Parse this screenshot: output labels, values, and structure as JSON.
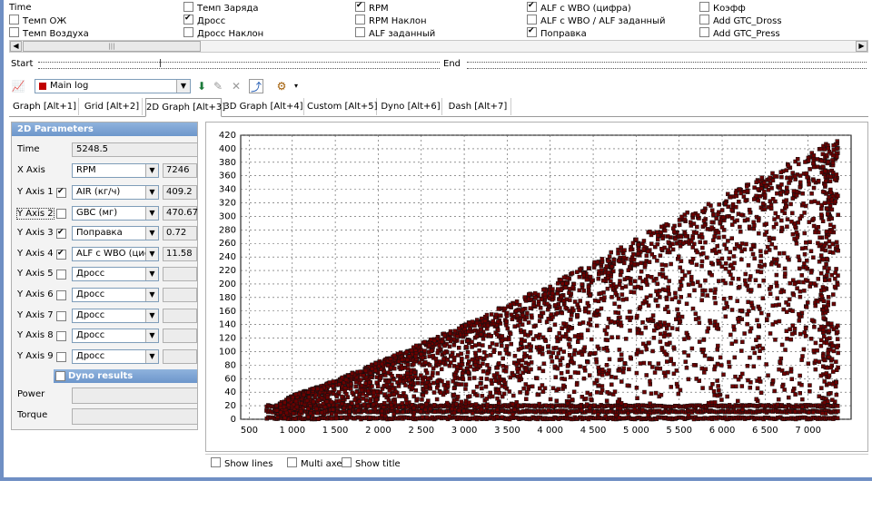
{
  "checkbox_columns": [
    [
      {
        "label": "Time",
        "checked": null
      },
      {
        "label": "Темп ОЖ",
        "checked": false
      },
      {
        "label": "Темп Воздуха",
        "checked": false
      }
    ],
    [
      {
        "label": "Темп Заряда",
        "checked": false
      },
      {
        "label": "Дросс",
        "checked": true
      },
      {
        "label": "Дросс Наклон",
        "checked": false
      }
    ],
    [
      {
        "label": "RPM",
        "checked": true
      },
      {
        "label": "RPM Наклон",
        "checked": false
      },
      {
        "label": "ALF заданный",
        "checked": false
      }
    ],
    [
      {
        "label": "ALF с WBO (цифра)",
        "checked": true
      },
      {
        "label": "ALF с WBO / ALF заданный",
        "checked": false
      },
      {
        "label": "Поправка",
        "checked": true
      }
    ],
    [
      {
        "label": "Коэфф",
        "checked": false
      },
      {
        "label": "Add GTC_Dross",
        "checked": false
      },
      {
        "label": "Add GTC_Press",
        "checked": false
      }
    ]
  ],
  "range": {
    "start_label": "Start",
    "end_label": "End"
  },
  "toolbar": {
    "log_name": "Main log"
  },
  "tabs": [
    {
      "label": "Graph [Alt+1]",
      "active": false
    },
    {
      "label": "Grid [Alt+2]",
      "active": false
    },
    {
      "label": "2D Graph [Alt+3]",
      "active": true
    },
    {
      "label": "3D Graph [Alt+4]",
      "active": false
    },
    {
      "label": "Custom [Alt+5]",
      "active": false
    },
    {
      "label": "Dyno [Alt+6]",
      "active": false
    },
    {
      "label": "Dash [Alt+7]",
      "active": false
    }
  ],
  "params": {
    "title": "2D Parameters",
    "time_label": "Time",
    "time_value": "5248.5",
    "x_axis": {
      "label": "X Axis",
      "param": "RPM",
      "value": "7246"
    },
    "y_axes": [
      {
        "label": "Y Axis 1",
        "checked": true,
        "param": "AIR (кг/ч)",
        "value": "409.2"
      },
      {
        "label": "Y Axis 2",
        "checked": false,
        "param": "GBC (мг)",
        "value": "470.67"
      },
      {
        "label": "Y Axis 3",
        "checked": true,
        "param": "Поправка",
        "value": "0.72"
      },
      {
        "label": "Y Axis 4",
        "checked": true,
        "param": "ALF с WBO (цифр",
        "value": "11.58"
      },
      {
        "label": "Y Axis 5",
        "checked": false,
        "param": "Дросс",
        "value": ""
      },
      {
        "label": "Y Axis 6",
        "checked": false,
        "param": "Дросс",
        "value": ""
      },
      {
        "label": "Y Axis 7",
        "checked": false,
        "param": "Дросс",
        "value": ""
      },
      {
        "label": "Y Axis 8",
        "checked": false,
        "param": "Дросс",
        "value": ""
      },
      {
        "label": "Y Axis 9",
        "checked": false,
        "param": "Дросс",
        "value": ""
      }
    ],
    "dyno_title": "Dyno results",
    "power_label": "Power",
    "torque_label": "Torque"
  },
  "bottom_options": [
    {
      "label": "Show lines",
      "checked": false
    },
    {
      "label": "Multi axes",
      "checked": false
    },
    {
      "label": "Show title",
      "checked": false
    }
  ],
  "chart_data": {
    "type": "scatter",
    "x_ticks": [
      "500",
      "1 000",
      "1 500",
      "2 000",
      "2 500",
      "3 000",
      "3 500",
      "4 000",
      "4 500",
      "5 000",
      "5 500",
      "6 000",
      "6 500",
      "7 000"
    ],
    "y_ticks": [
      "0",
      "20",
      "40",
      "60",
      "80",
      "100",
      "120",
      "140",
      "160",
      "180",
      "200",
      "220",
      "240",
      "260",
      "280",
      "300",
      "320",
      "340",
      "360",
      "380",
      "400",
      "420"
    ],
    "xlim": [
      400,
      7500
    ],
    "ylim": [
      0,
      420
    ],
    "grid": true,
    "marker_color": "#6b0000",
    "envelope_upper": [
      [
        700,
        12
      ],
      [
        1000,
        35
      ],
      [
        1500,
        58
      ],
      [
        2000,
        85
      ],
      [
        2500,
        112
      ],
      [
        3000,
        140
      ],
      [
        3500,
        170
      ],
      [
        4000,
        200
      ],
      [
        4500,
        232
      ],
      [
        5000,
        268
      ],
      [
        5500,
        300
      ],
      [
        6000,
        330
      ],
      [
        6500,
        360
      ],
      [
        7000,
        395
      ],
      [
        7300,
        412
      ]
    ],
    "baseline_bands": [
      0,
      10,
      18
    ]
  }
}
